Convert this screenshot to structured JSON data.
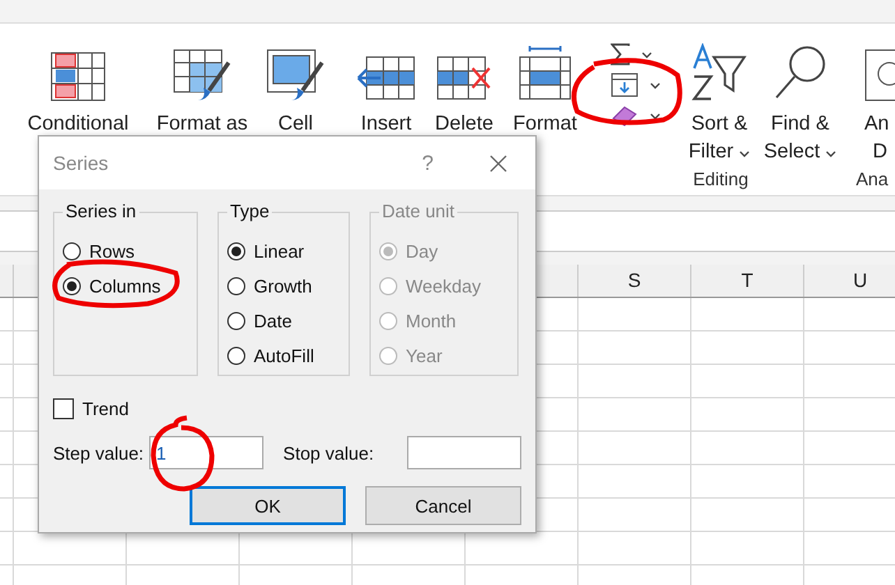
{
  "ribbon": {
    "styles": [
      {
        "label": "Conditional"
      },
      {
        "label": "Format as"
      },
      {
        "label": "Cell"
      }
    ],
    "cells": [
      {
        "label": "Insert"
      },
      {
        "label": "Delete"
      },
      {
        "label": "Format"
      }
    ],
    "editing": {
      "label": "Editing",
      "buttons": [
        {
          "lines": [
            "Sort &",
            "Filter"
          ]
        },
        {
          "lines": [
            "Find &",
            "Select"
          ]
        }
      ]
    },
    "analyze": {
      "lines": [
        "An",
        "D"
      ],
      "label": "Ana"
    }
  },
  "sheet": {
    "columns": [
      "S",
      "T",
      "U"
    ]
  },
  "dialog": {
    "title": "Series",
    "help": "?",
    "groups": [
      {
        "label": "Series in",
        "disabled": false,
        "options": [
          {
            "label": "Rows",
            "selected": false
          },
          {
            "label": "Columns",
            "selected": true
          }
        ]
      },
      {
        "label": "Type",
        "disabled": false,
        "options": [
          {
            "label": "Linear",
            "selected": true
          },
          {
            "label": "Growth",
            "selected": false
          },
          {
            "label": "Date",
            "selected": false
          },
          {
            "label": "AutoFill",
            "selected": false
          }
        ]
      },
      {
        "label": "Date unit",
        "disabled": true,
        "options": [
          {
            "label": "Day",
            "selected": true
          },
          {
            "label": "Weekday",
            "selected": false
          },
          {
            "label": "Month",
            "selected": false
          },
          {
            "label": "Year",
            "selected": false
          }
        ]
      }
    ],
    "trend": {
      "label": "Trend",
      "checked": false
    },
    "step": {
      "label": "Step value:",
      "value": "1"
    },
    "stop": {
      "label": "Stop value:"
    },
    "buttons": [
      {
        "label": "OK",
        "default": true
      },
      {
        "label": "Cancel",
        "default": false
      }
    ]
  }
}
